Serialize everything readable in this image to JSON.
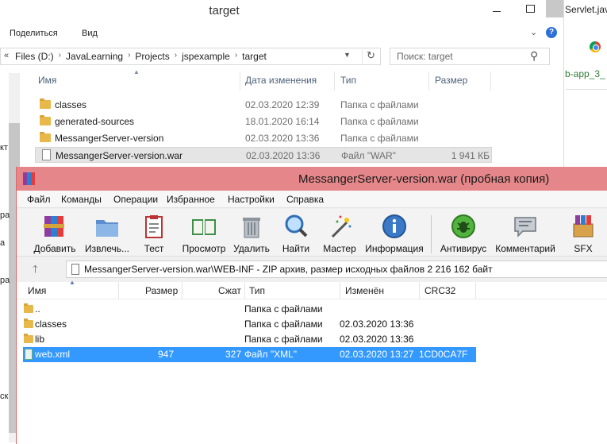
{
  "explorer": {
    "title": "target",
    "ribbon": {
      "share": "Поделиться",
      "view": "Вид"
    },
    "breadcrumbs": [
      "Files (D:)",
      "JavaLearning",
      "Projects",
      "jspexample",
      "target"
    ],
    "search_placeholder": "Поиск: target",
    "nav_partial": [
      "кт",
      "ра",
      "а",
      "ра",
      "ск"
    ],
    "columns": {
      "name": "Имя",
      "date": "Дата изменения",
      "type": "Тип",
      "size": "Размер"
    },
    "rows": [
      {
        "name": "classes",
        "date": "02.03.2020 12:39",
        "type": "Папка с файлами",
        "size": "",
        "kind": "folder"
      },
      {
        "name": "generated-sources",
        "date": "18.01.2020 16:14",
        "type": "Папка с файлами",
        "size": "",
        "kind": "folder"
      },
      {
        "name": "MessangerServer-version",
        "date": "02.03.2020 13:36",
        "type": "Папка с файлами",
        "size": "",
        "kind": "folder"
      },
      {
        "name": "MessangerServer-version.war",
        "date": "02.03.2020 13:36",
        "type": "Файл \"WAR\"",
        "size": "1 941 КБ",
        "kind": "file"
      }
    ]
  },
  "background": {
    "tab_text": "Servlet.java",
    "web_text": "b-app_3_"
  },
  "winrar": {
    "title": "MessangerServer-version.war (пробная копия)",
    "menu": [
      "Файл",
      "Команды",
      "Операции",
      "Избранное",
      "Настройки",
      "Справка"
    ],
    "toolbar": [
      {
        "label": "Добавить",
        "icon": "add-archive-icon"
      },
      {
        "label": "Извлечь...",
        "icon": "extract-folder-icon"
      },
      {
        "label": "Тест",
        "icon": "test-clipboard-icon"
      },
      {
        "label": "Просмотр",
        "icon": "view-book-icon"
      },
      {
        "label": "Удалить",
        "icon": "trash-icon"
      },
      {
        "label": "Найти",
        "icon": "magnifier-icon"
      },
      {
        "label": "Мастер",
        "icon": "wizard-wand-icon"
      },
      {
        "label": "Информация",
        "icon": "info-icon"
      },
      {
        "label": "Антивирус",
        "icon": "antivirus-bug-icon"
      },
      {
        "label": "Комментарий",
        "icon": "comment-icon"
      },
      {
        "label": "SFX",
        "icon": "sfx-box-icon"
      }
    ],
    "path": "MessangerServer-version.war\\WEB-INF - ZIP архив, размер исходных файлов 2 216 162 байт",
    "columns": {
      "name": "Имя",
      "size": "Размер",
      "packed": "Сжат",
      "type": "Тип",
      "modified": "Изменён",
      "crc": "CRC32"
    },
    "rows": [
      {
        "name": "..",
        "size": "",
        "packed": "",
        "type": "Папка с файлами",
        "modified": "",
        "crc": "",
        "kind": "folder"
      },
      {
        "name": "classes",
        "size": "",
        "packed": "",
        "type": "Папка с файлами",
        "modified": "02.03.2020 13:36",
        "crc": "",
        "kind": "folder"
      },
      {
        "name": "lib",
        "size": "",
        "packed": "",
        "type": "Папка с файлами",
        "modified": "02.03.2020 13:36",
        "crc": "",
        "kind": "folder"
      },
      {
        "name": "web.xml",
        "size": "947",
        "packed": "327",
        "type": "Файл \"XML\"",
        "modified": "02.03.2020 13:27",
        "crc": "1CD0CA7F",
        "kind": "xml",
        "selected": true
      }
    ]
  },
  "colors": {
    "rar_title_bg": "#e5878a",
    "selection": "#3399ff",
    "folder": "#e8b94a"
  }
}
